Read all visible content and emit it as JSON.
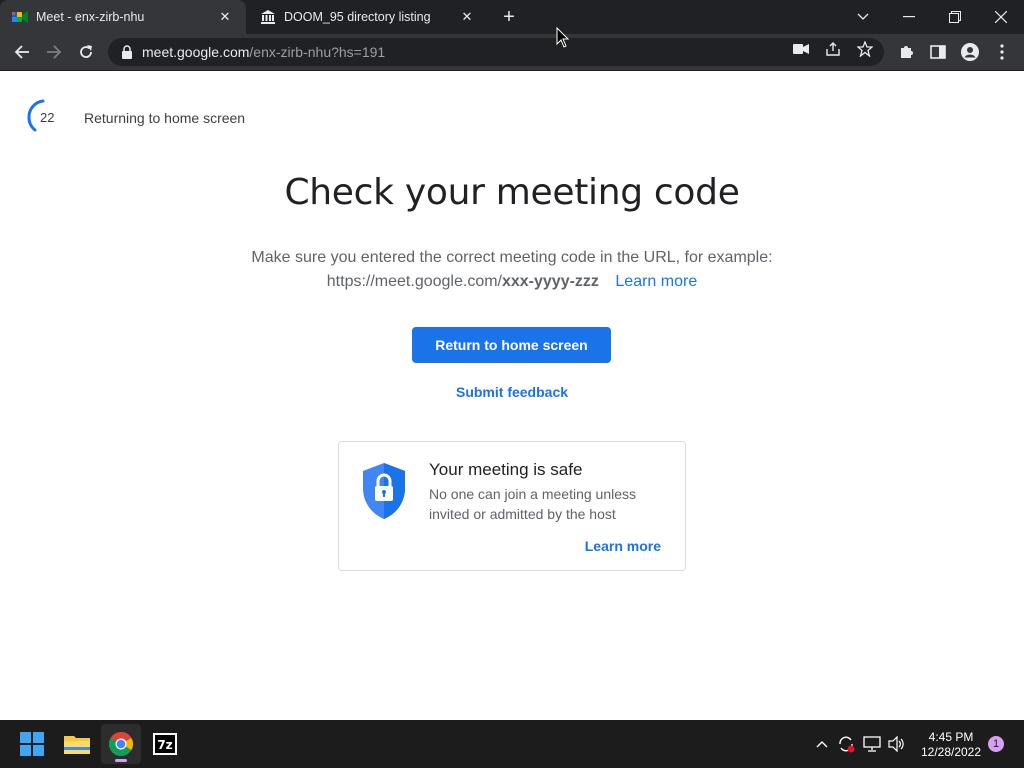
{
  "browser": {
    "tabs": [
      {
        "title": "Meet - enx-zirb-nhu",
        "icon": "google-meet-icon",
        "active": true
      },
      {
        "title": "DOOM_95 directory listing",
        "icon": "archive-building-icon",
        "active": false
      }
    ],
    "url_host": "meet.google.com",
    "url_path": "/enx-zirb-nhu?hs=191"
  },
  "page": {
    "countdown_value": "22",
    "countdown_text": "Returning to home screen",
    "heading": "Check your meeting code",
    "description_line1": "Make sure you entered the correct meeting code in the URL, for example:",
    "example_url_prefix": "https://meet.google.com/",
    "example_code": "xxx-yyyy-zzz",
    "learn_more_inline": "Learn more",
    "primary_button": "Return to home screen",
    "feedback_link": "Submit feedback",
    "safety_card": {
      "title": "Your meeting is safe",
      "body": "No one can join a meeting unless invited or admitted by the host",
      "link": "Learn more"
    }
  },
  "taskbar": {
    "apps": [
      "windows-start-icon",
      "file-explorer-icon",
      "chrome-icon",
      "7zip-icon"
    ],
    "time": "4:45 PM",
    "date": "12/28/2022",
    "notification_count": "1"
  },
  "colors": {
    "accent": "#1a73e8",
    "chrome_dark": "#202124",
    "chrome_toolbar": "#35363a",
    "taskbar": "#1c1c1c"
  }
}
